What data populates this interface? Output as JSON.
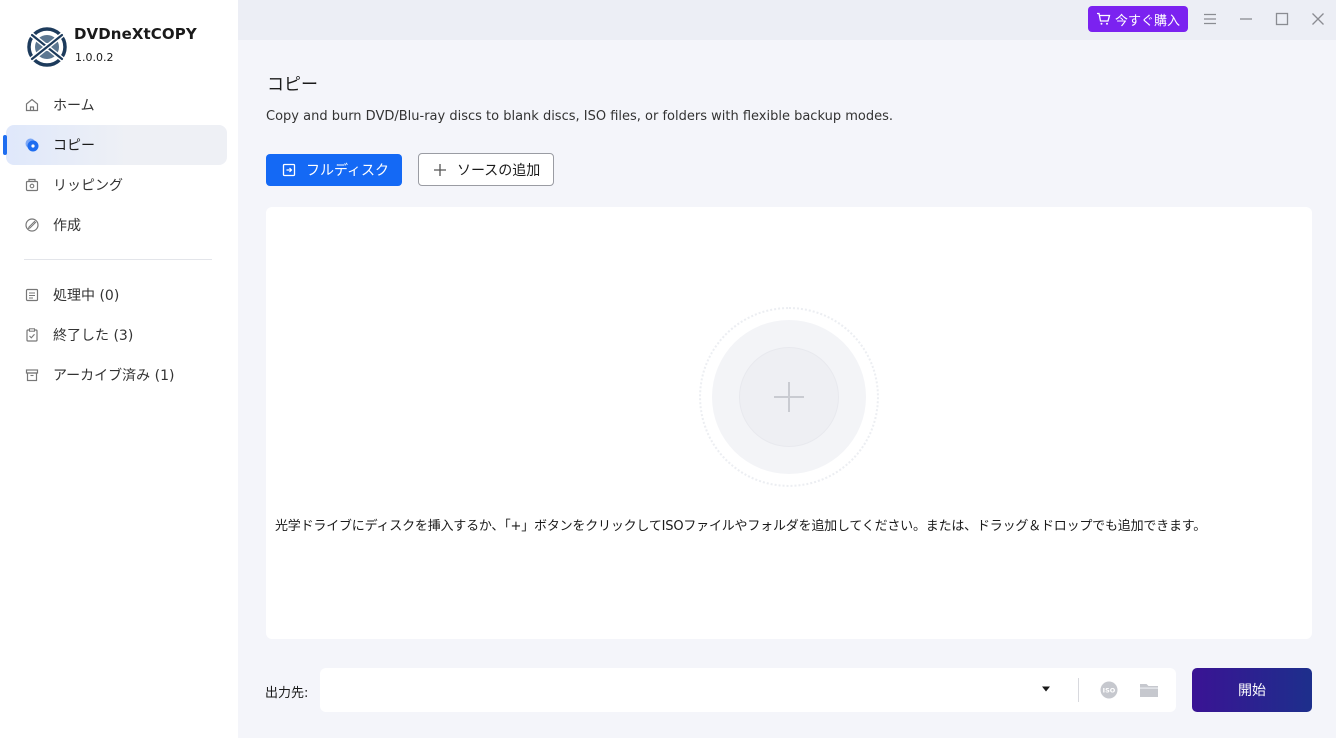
{
  "app": {
    "name": "DVDneXtCOPY",
    "version": "1.0.0.2"
  },
  "sidebar": {
    "nav": [
      {
        "label": "ホーム",
        "icon": "home-icon",
        "active": false
      },
      {
        "label": "コピー",
        "icon": "copy-disc-icon",
        "active": true
      },
      {
        "label": "リッピング",
        "icon": "ripping-icon",
        "active": false
      },
      {
        "label": "作成",
        "icon": "create-icon",
        "active": false
      }
    ],
    "queues": [
      {
        "label": "処理中 (0)",
        "icon": "processing-list-icon"
      },
      {
        "label": "終了した (3)",
        "icon": "finished-clipboard-icon"
      },
      {
        "label": "アーカイブ済み (1)",
        "icon": "archive-box-icon"
      }
    ]
  },
  "titlebar": {
    "buy_label": "今すぐ購入",
    "buy_color": "#7b22f0"
  },
  "main": {
    "title": "コピー",
    "description": "Copy and burn DVD/Blu-ray discs to blank discs, ISO files, or folders with flexible backup modes.",
    "full_disc_label": "フルディスク",
    "add_source_label": "ソースの追加",
    "drop_hint": "光学ドライブにディスクを挿入するか、「+」ボタンをクリックしてISOファイルやフォルダを追加してください。または、ドラッグ＆ドロップでも追加できます。",
    "output_label": "出力先:",
    "output_value": "",
    "iso_icon_text": "ISO",
    "start_label": "開始",
    "accent_color": "#1469f5"
  }
}
